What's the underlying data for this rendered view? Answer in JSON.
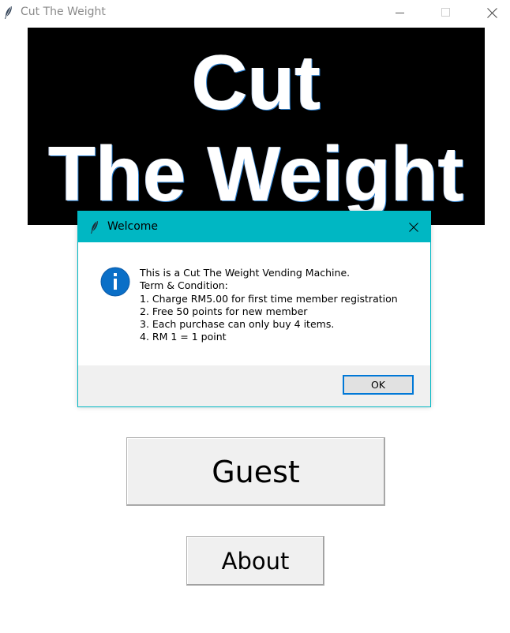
{
  "window": {
    "title": "Cut The Weight",
    "controls": {
      "minimize": "minimize-icon",
      "maximize": "maximize-icon",
      "close": "close-icon"
    }
  },
  "banner": {
    "line1": "Cut",
    "line2": "The Weight"
  },
  "main": {
    "guest_label": "Guest",
    "about_label": "About"
  },
  "dialog": {
    "title": "Welcome",
    "icon": "info-icon",
    "message_lines": [
      "This is a Cut The Weight Vending Machine.",
      "Term & Condition:",
      "1. Charge RM5.00 for first time member registration",
      "2. Free 50 points for new member",
      "3. Each purchase can only buy 4 items.",
      "4. RM 1 = 1 point"
    ],
    "ok_label": "OK"
  },
  "colors": {
    "dialog_accent": "#00b7c3",
    "info_icon": "#0a6fc7",
    "ok_focus": "#0078d7",
    "banner_bg": "#000000"
  }
}
